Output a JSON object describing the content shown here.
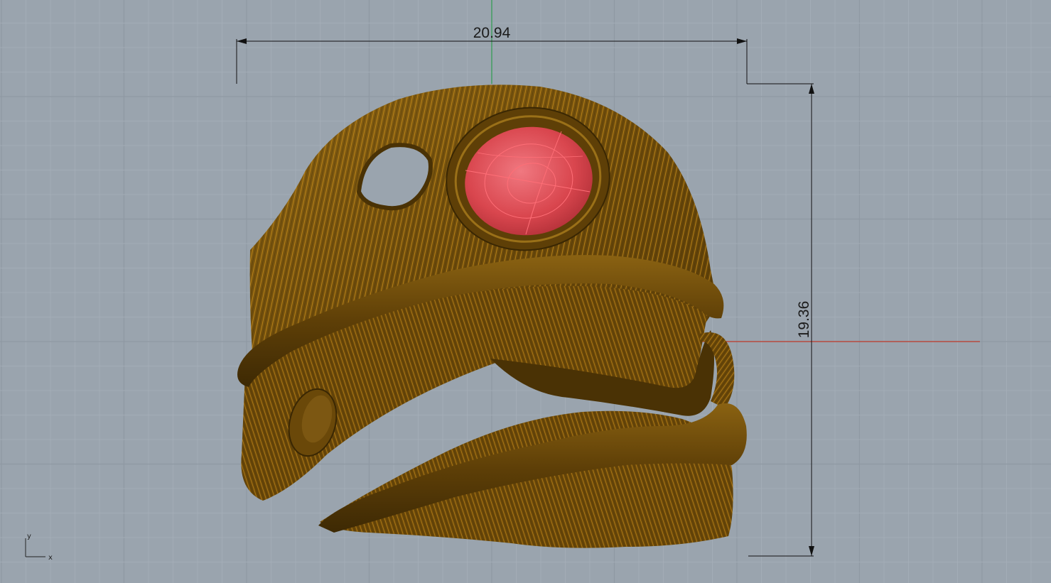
{
  "viewport": {
    "background": "#9aa4ae",
    "grid_minor_color": "#a6afb8",
    "grid_major_color": "#8f99a3",
    "x_axis_color": "#c0392b",
    "y_axis_color": "#2e9e4f"
  },
  "dimensions": {
    "horizontal": "20.94",
    "vertical": "19.36"
  },
  "axis_icon": {
    "x": "x",
    "y": "y"
  },
  "model": {
    "body_color": "#7a5510",
    "rib_color": "#c98d1a",
    "gem_color": "#e04a52",
    "gem_wire_color": "#ff6f77"
  }
}
